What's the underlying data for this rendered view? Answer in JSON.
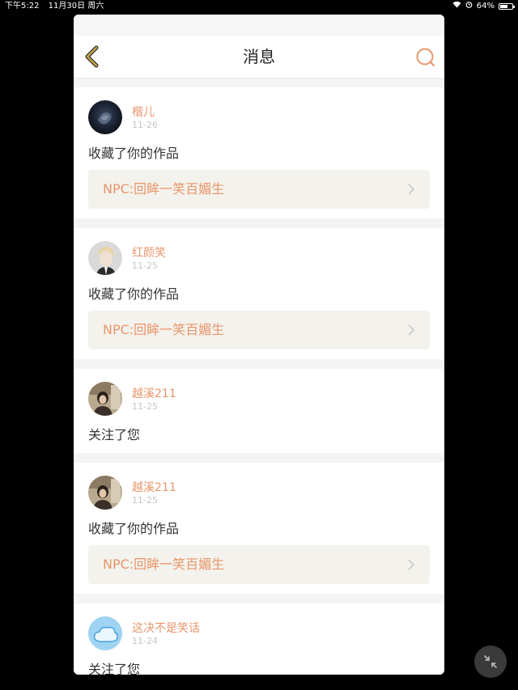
{
  "status_bar": {
    "time": "下午5:22",
    "date": "11月30日 周六",
    "battery": "64%",
    "battery_level": 0.64
  },
  "header": {
    "title": "消息",
    "back_icon": "chevron-left-icon",
    "search_icon": "search-icon"
  },
  "colors": {
    "accent": "#e9956b",
    "back_icon": "#c8a64a",
    "search_icon": "#e9956b"
  },
  "messages": [
    {
      "user": "楷儿",
      "date": "11-26",
      "action": "收藏了你的作品",
      "work": "NPC:回眸一笑百媚生",
      "avatar": "avatar-dark-rose"
    },
    {
      "user": "红颜笑",
      "date": "11-25",
      "action": "收藏了你的作品",
      "work": "NPC:回眸一笑百媚生",
      "avatar": "avatar-portrait-blond"
    },
    {
      "user": "越溪211",
      "date": "11-25",
      "action": "关注了您",
      "work": null,
      "avatar": "avatar-girl-photo"
    },
    {
      "user": "越溪211",
      "date": "11-25",
      "action": "收藏了你的作品",
      "work": "NPC:回眸一笑百媚生",
      "avatar": "avatar-girl-photo"
    },
    {
      "user": "这决不是笑话",
      "date": "11-24",
      "action": "关注了您",
      "work": null,
      "avatar": "avatar-blue-cloud"
    }
  ]
}
